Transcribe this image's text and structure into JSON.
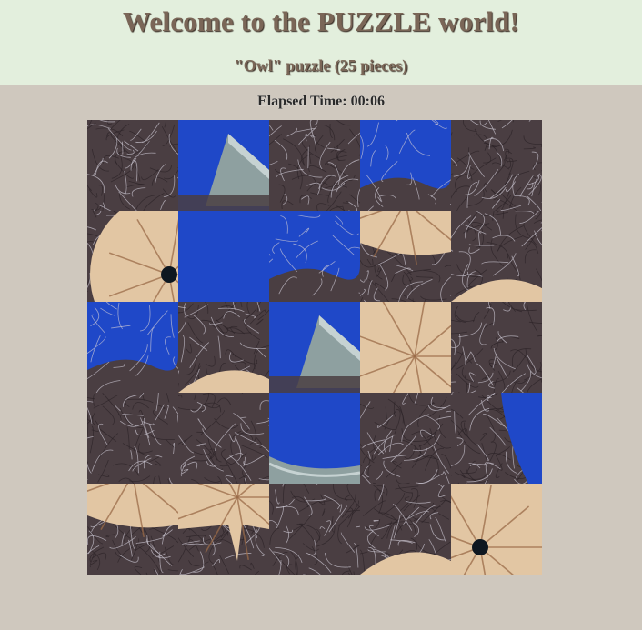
{
  "header": {
    "title": "Welcome to the PUZZLE world!",
    "subtitle": "\"Owl\" puzzle (25 pieces)"
  },
  "timer": {
    "label": "Elapsed Time:",
    "value": "00:06"
  },
  "colors": {
    "header_bg": "#e3efdd",
    "page_bg": "#cfc8be",
    "title_text": "#7a6657",
    "fur": "#4a3e42",
    "fur_light": "#cfcbd6",
    "sky": "#1f48c8",
    "wood": "#e2c6a3",
    "metal": "#8ea0a0"
  },
  "puzzle": {
    "name": "Owl",
    "piece_count": 25,
    "tiles": [
      {
        "kind": "fur"
      },
      {
        "kind": "metal-sky"
      },
      {
        "kind": "fur"
      },
      {
        "kind": "sky-fur"
      },
      {
        "kind": "fur"
      },
      {
        "kind": "wood-eye-left"
      },
      {
        "kind": "sky"
      },
      {
        "kind": "sky-fur"
      },
      {
        "kind": "wood-fur"
      },
      {
        "kind": "fur-wood"
      },
      {
        "kind": "sky-fur"
      },
      {
        "kind": "fur-wood"
      },
      {
        "kind": "metal-sky"
      },
      {
        "kind": "wood"
      },
      {
        "kind": "fur"
      },
      {
        "kind": "fur"
      },
      {
        "kind": "fur"
      },
      {
        "kind": "sky-metal"
      },
      {
        "kind": "fur"
      },
      {
        "kind": "fur-sky"
      },
      {
        "kind": "wood-fur"
      },
      {
        "kind": "wood-beak"
      },
      {
        "kind": "fur"
      },
      {
        "kind": "fur-wood"
      },
      {
        "kind": "wood-eye"
      }
    ]
  }
}
